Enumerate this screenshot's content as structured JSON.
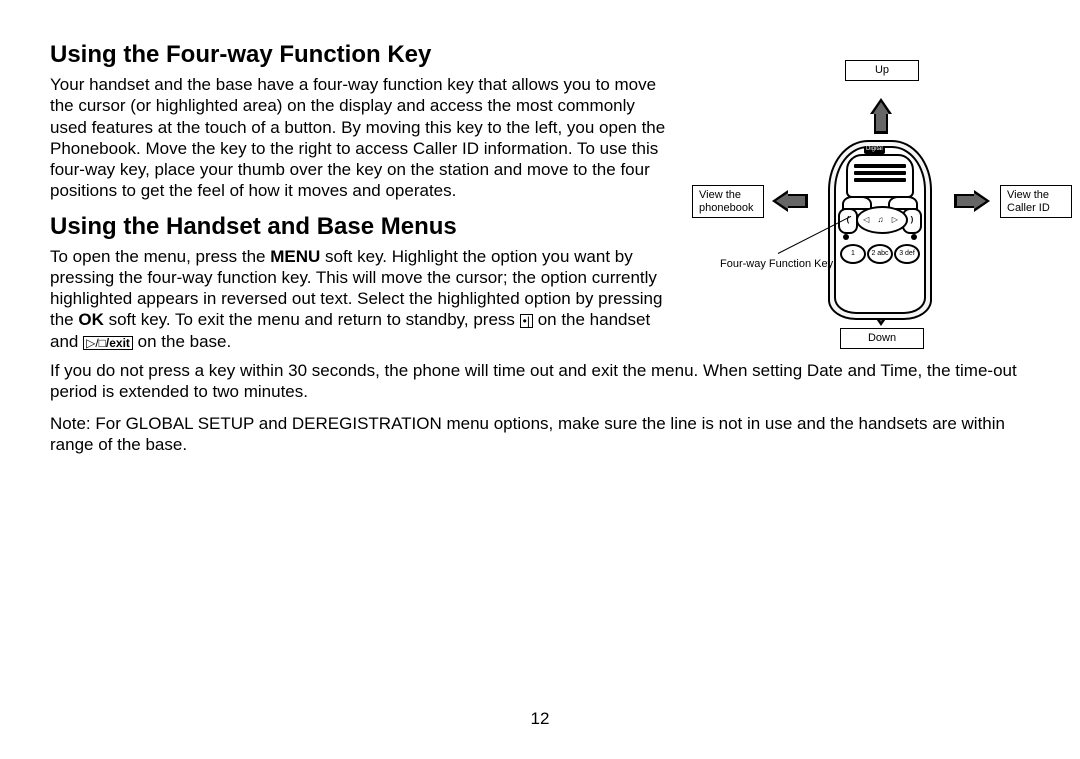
{
  "heading1": "Using the Four-way Function Key",
  "para1": "Your handset and the base have a four-way function key that allows you to move the cursor (or highlighted area) on the display and access the most commonly used features at the touch of a button. By moving this key to the left, you open the Phonebook. Move the key to the right to access Caller ID information. To use this four-way key, place your thumb over the key on the station and move to the four positions to get the feel of how it moves and operates.",
  "heading2": "Using the Handset and Base Menus",
  "para2a": "To open the menu, press the ",
  "menu_label": "MENU",
  "para2b": " soft key. Highlight the option you want by pressing the four-way function key. This will move the cursor; the option currently highlighted appears in reversed out text. Select the highlighted option by pressing the ",
  "ok_label": "OK",
  "para2c": " soft key. To exit the menu and return to standby, press ",
  "icon1": "•|",
  "para2d": " on the handset and ",
  "icon2": "▷/□",
  "exit_label": "/exit",
  "para2e": " on the base.",
  "para3": "If you do not press a key within 30 seconds, the phone will time out and exit the menu. When setting Date and Time, the time-out period is extended to two minutes.",
  "para4": "Note: For GLOBAL SETUP and DEREGISTRATION menu options, make sure the line is not in use and the handsets are within range of the base.",
  "diagram": {
    "up": "Up",
    "down": "Down",
    "left": "View the phonebook",
    "right": "View the Caller ID",
    "caption": "Four-way Function Key",
    "key1": "1",
    "key2": "2 abc",
    "key3": "3 def",
    "brand": "Digital"
  },
  "page_number": "12"
}
